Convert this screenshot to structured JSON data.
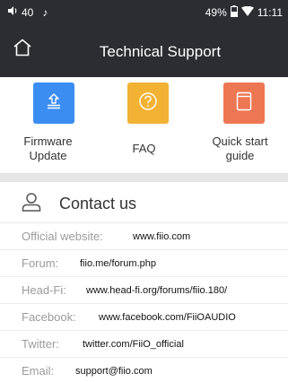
{
  "status_bar": {
    "volume": "40",
    "music_note": "♪",
    "battery": "49%",
    "time": "11:11"
  },
  "header": {
    "title": "Technical Support",
    "home_icon": "home-icon"
  },
  "support_items": [
    {
      "label": "Firmware\nUpdate",
      "icon": "upload-icon",
      "color": "#3b8df1"
    },
    {
      "label": "FAQ",
      "icon": "question-icon",
      "color": "#f2b233"
    },
    {
      "label": "Quick start\nguide",
      "icon": "book-icon",
      "color": "#ee7753"
    }
  ],
  "contact": {
    "title": "Contact us",
    "icon": "person-icon",
    "rows": [
      {
        "label": "Official website:",
        "value": "www.fiio.com"
      },
      {
        "label": "Forum:",
        "value": "fiio.me/forum.php"
      },
      {
        "label": "Head-Fi:",
        "value": "www.head-fi.org/forums/fiio.180/"
      },
      {
        "label": "Facebook:",
        "value": "www.facebook.com/FiiOAUDIO"
      },
      {
        "label": "Twitter:",
        "value": "twitter.com/FiiO_official"
      },
      {
        "label": "Email:",
        "value": "support@fiio.com"
      }
    ]
  }
}
